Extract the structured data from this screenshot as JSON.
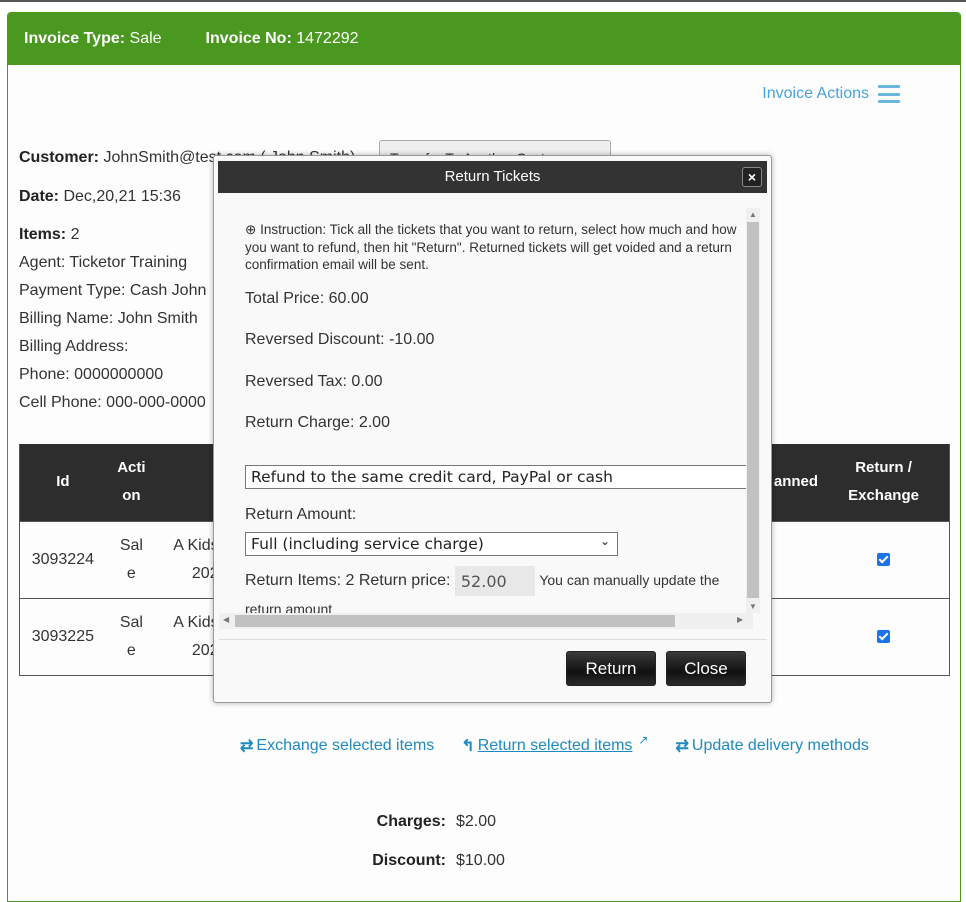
{
  "header": {
    "invoice_type_label": "Invoice Type:",
    "invoice_type_value": "Sale",
    "invoice_no_label": "Invoice No:",
    "invoice_no_value": "1472292"
  },
  "invoice_actions": {
    "label": "Invoice Actions",
    "icon": "hamburger-menu-icon"
  },
  "customer": {
    "customer_label": "Customer:",
    "customer_value": "JohnSmith@test.com ( John Smith)",
    "transfer_button": "Transfer To Another Customer",
    "date_label": "Date:",
    "date_value": "Dec,20,21 15:36",
    "items_label": "Items:",
    "items_value": "2",
    "agent": "Agent: Ticketor Training",
    "payment_type": "Payment Type: Cash John",
    "billing_name": "Billing Name: John Smith",
    "billing_address": "Billing Address:",
    "phone": "Phone: 0000000000",
    "cell_phone": "Cell Phone: 000-000-0000"
  },
  "table": {
    "headers": {
      "id": "Id",
      "action_1": "Acti",
      "action_2": "on",
      "scanned": "anned",
      "return_1": "Return /",
      "return_2": "Exchange"
    },
    "rows": [
      {
        "id": "3093224",
        "action_1": "Sal",
        "action_2": "e",
        "event_1": "A Kids",
        "event_2": "202",
        "checked": true
      },
      {
        "id": "3093225",
        "action_1": "Sal",
        "action_2": "e",
        "event_1": "A Kids",
        "event_2": "202",
        "checked": true
      }
    ]
  },
  "links": {
    "exchange": "Exchange selected items",
    "return": "Return selected items",
    "update_delivery": "Update delivery methods"
  },
  "totals": {
    "charges_label": "Charges:",
    "charges_value": "$2.00",
    "discount_label": "Discount:",
    "discount_value": "$10.00"
  },
  "modal": {
    "title": "Return Tickets",
    "close_icon": "×",
    "instruction": "Instruction: Tick all the tickets that you want to return, select how much and how you want to refund, then hit \"Return\". Returned tickets will get voided and a return confirmation email will be sent.",
    "total_price": "Total Price: 60.00",
    "reversed_discount": "Reversed Discount: -10.00",
    "reversed_tax": "Reversed Tax: 0.00",
    "return_charge": "Return Charge: 2.00",
    "refund_method": "Refund to the same credit card, PayPal or cash",
    "return_amount_label": "Return Amount:",
    "return_amount_selected": "Full (including service charge)",
    "return_items_text": "Return Items: 2 Return price:",
    "return_price_value": "52.00",
    "manual_note_1": "You can manually update the",
    "manual_note_2": "return amount",
    "return_button": "Return",
    "close_button": "Close"
  }
}
